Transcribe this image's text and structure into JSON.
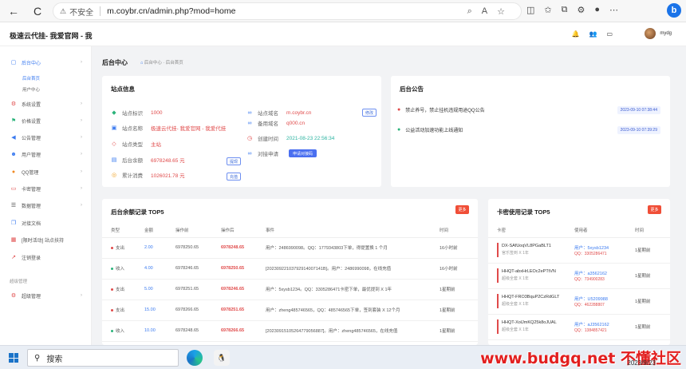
{
  "browser": {
    "back": "←",
    "reload": "C",
    "warning_icon": "⚠",
    "insecure": "不安全",
    "url": "m.coybr.cn/admin.php?mod=home"
  },
  "header": {
    "site_title": "极速云代挂- 我爱官网 - 我",
    "user_name": "mydg"
  },
  "sidebar": {
    "items": [
      {
        "label": "后台中心",
        "icon": "monitor-icon",
        "active": true
      },
      {
        "label": "系统设置",
        "icon": "gear-icon"
      },
      {
        "label": "价格设置",
        "icon": "flag-icon"
      },
      {
        "label": "公告管理",
        "icon": "megaphone-icon"
      },
      {
        "label": "用户管理",
        "icon": "users-icon"
      },
      {
        "label": "QQ管理",
        "icon": "qq-icon"
      },
      {
        "label": "卡密管理",
        "icon": "card-icon"
      },
      {
        "label": "数据管理",
        "icon": "list-icon"
      },
      {
        "label": "对接文档",
        "icon": "doc-icon"
      },
      {
        "label": "[限时活动] 站点扶持",
        "icon": "gift-icon"
      },
      {
        "label": "注销登录",
        "icon": "logout-icon"
      }
    ],
    "sub_items": [
      "后台首页",
      "用户中心"
    ],
    "group_label": "超级管理",
    "group_item": "超级管理"
  },
  "page": {
    "title": "后台中心",
    "breadcrumb": "后台中心 · 后台首页"
  },
  "site_info": {
    "title": "站点信息",
    "rows_left": [
      {
        "label": "站点标识",
        "value": "1000"
      },
      {
        "label": "站点名称",
        "value": "极速云代挂- 我爱官网 - 我爱代挂"
      },
      {
        "label": "站点类型",
        "value": "主站"
      },
      {
        "label": "后台余额",
        "value": "6978248.65 元"
      },
      {
        "label": "累计消费",
        "value": "1026021.78 元"
      }
    ],
    "rows_right": [
      {
        "label": "站点域名",
        "value": "m.coybr.cn"
      },
      {
        "label": "备用域名",
        "value": "q000.cn"
      },
      {
        "label": "创建时间",
        "value": "2021-08-23 22:56:34"
      },
      {
        "label": "对接申请",
        "value": ""
      }
    ],
    "edit_btn": "修改",
    "recharge_btn": "提现",
    "consume_btn": "充值",
    "apply_btn": "申请对接码"
  },
  "notices": {
    "title": "后台公告",
    "items": [
      {
        "text": "禁止养号，禁止挂机违规用途QQ公告",
        "date": "2023-09-10 07:38:44"
      },
      {
        "text": "公益活动加速功能上线通知",
        "date": "2023-09-10 07:39:29"
      }
    ]
  },
  "balance_log": {
    "title": "后台余额记录 TOP5",
    "more": "更多",
    "columns": [
      "类型",
      "金额",
      "操作前",
      "操作后",
      "事件",
      "时间"
    ],
    "rows": [
      {
        "type": "支出",
        "amount": "2.00",
        "before": "6978250.65",
        "after": "6978248.65",
        "event": "用户：2486990098。QQ：1779343803下单，得提置换 1 个月",
        "time": "16小时前"
      },
      {
        "type": "收入",
        "amount": "4.00",
        "before": "6978246.65",
        "after": "6978250.65",
        "event": "[20230922103792914007141B]。用户：2486990098，在线充值",
        "time": "16小时前"
      },
      {
        "type": "支出",
        "amount": "5.00",
        "before": "6978251.65",
        "after": "6978246.65",
        "event": "用户：5xysb1234。QQ：3305286471卡密下单，最优提到 X 1年",
        "time": "1星期前"
      },
      {
        "type": "支出",
        "amount": "15.00",
        "before": "6978266.65",
        "after": "6978251.65",
        "event": "用户：zheng485746565，QQ：485746565下单，签到套装 X 12个月",
        "time": "1星期前"
      },
      {
        "type": "收入",
        "amount": "10.00",
        "before": "6978248.65",
        "after": "6978266.65",
        "event": "[20230915105264779056887]。用户：zheng485746565，在线充值",
        "time": "1星期前"
      }
    ]
  },
  "card_log": {
    "title": "卡密使用记录 TOP5",
    "more": "更多",
    "columns": [
      "卡密",
      "使用者",
      "时间"
    ],
    "rows": [
      {
        "code": "DX-SAfUoqVL8PGaBLT1",
        "desc": "官乐签到 X 1年",
        "user": "用户：5xysb1234",
        "qq": "QQ：3305286471",
        "time": "1星期前"
      },
      {
        "code": "HHQT-abxHrLEOc2ePTtVN",
        "desc": "超级全套 X 1年",
        "user": "用户：a3562162",
        "qq": "QQ：734900283",
        "time": "1星期前"
      },
      {
        "code": "HHQT-FRO3BquP2CzRdGLT",
        "desc": "超级全套 X 1年",
        "user": "用户：U5209988",
        "qq": "QQ：462288807",
        "time": "1星期前"
      },
      {
        "code": "HHQT-XolJmKQ25k8oJUAL",
        "desc": "超级全套 X 1年",
        "user": "用户：aJ3562162",
        "qq": "QQ：1384857421",
        "time": "1星期前"
      }
    ]
  },
  "taskbar": {
    "search_placeholder": "搜索",
    "watermark": "www.budgq.net  不懂社区",
    "date": "2023/9/23"
  }
}
